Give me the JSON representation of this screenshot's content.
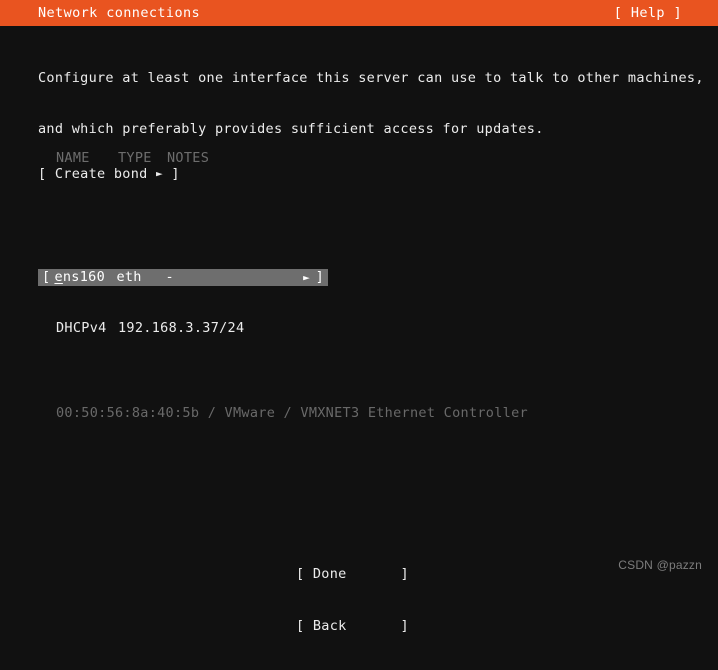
{
  "header": {
    "title": "Network connections",
    "help_label": "[ Help ]",
    "accent_color": "#e95420",
    "text_color": "#ffffff"
  },
  "intro": {
    "line1": "Configure at least one interface this server can use to talk to other machines,",
    "line2": "and which preferably provides sufficient access for updates."
  },
  "table": {
    "columns": {
      "name": "NAME",
      "type": "TYPE",
      "notes": "NOTES"
    },
    "rows": [
      {
        "bracket_left": "[",
        "hotkey": "e",
        "name_rest": "ns160",
        "type": "eth",
        "notes": "-",
        "arrow": "►",
        "bracket_right": "]",
        "selected": true,
        "details": [
          {
            "label": "DHCPv4",
            "value": "192.168.3.37/24",
            "dim": false
          },
          {
            "label": "00:50:56:8a:40:5b / VMware / VMXNET3 Ethernet Controller",
            "value": "",
            "dim": true
          }
        ]
      }
    ]
  },
  "create_bond": {
    "bracket_left": "[",
    "label": "Create bond",
    "arrow": "►",
    "bracket_right": "]"
  },
  "buttons": [
    {
      "bracket_left": "[",
      "label": " Done",
      "bracket_right": "]"
    },
    {
      "bracket_left": "[",
      "label": " Back",
      "bracket_right": "]"
    }
  ],
  "watermark": "CSDN @pazzn",
  "colors": {
    "background": "#111111",
    "selection": "#6e6e6e",
    "dim_text": "#696969",
    "text": "#ececec"
  }
}
